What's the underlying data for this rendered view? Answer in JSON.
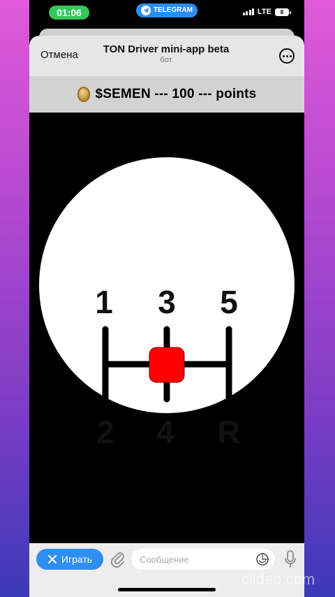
{
  "status_bar": {
    "time": "01:06",
    "telegram_label": "TELEGRAM",
    "network": "LTE",
    "battery": "8"
  },
  "header": {
    "cancel_label": "Отмена",
    "title": "TON Driver mini-app beta",
    "subtitle": "бот"
  },
  "points_bar": {
    "text": "$SEMEN --- 100 --- points",
    "coin_icon": "coin-icon"
  },
  "shifter": {
    "gears_top": [
      "1",
      "3",
      "5"
    ],
    "gears_bottom": [
      "2",
      "4",
      "R"
    ],
    "knob_color": "#ff0000",
    "plate_color": "#ffffff"
  },
  "bottom_bar": {
    "play_label": "Играть",
    "message_placeholder": "Сообщение"
  },
  "colors": {
    "accent": "#2f8ef0",
    "time_pill": "#34c759"
  },
  "watermark": "clideo.com"
}
